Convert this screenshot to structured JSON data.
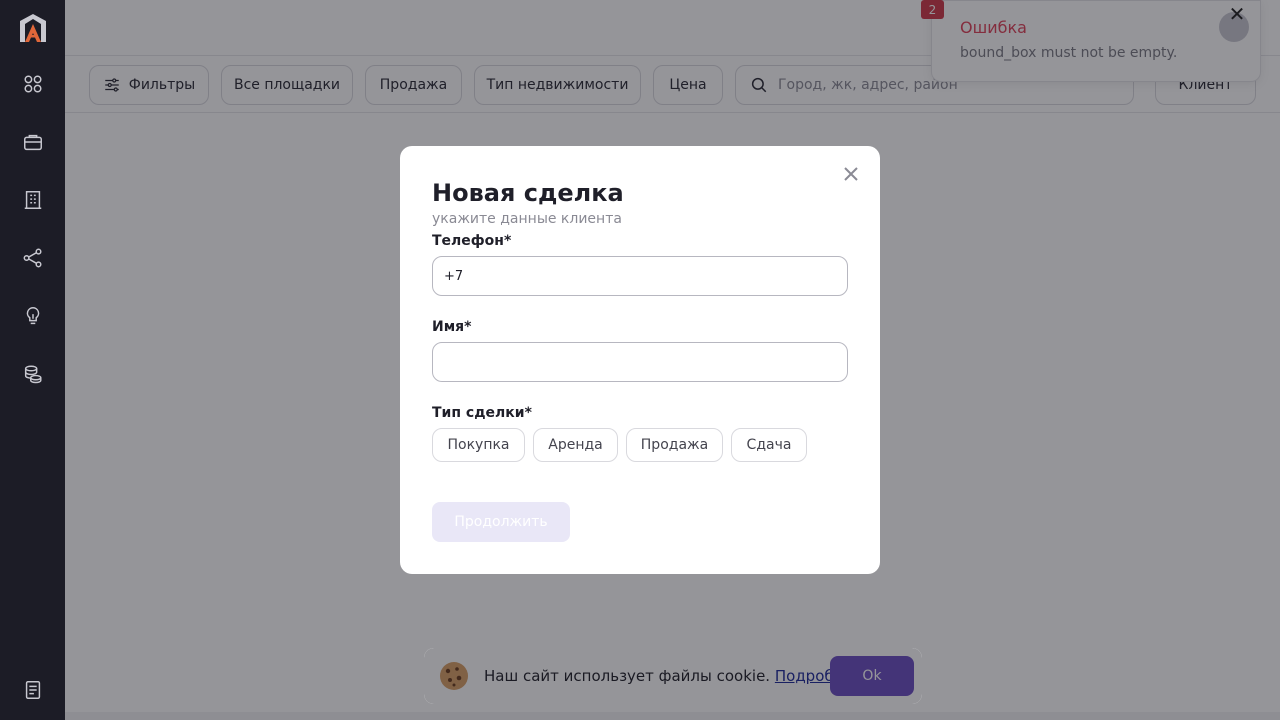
{
  "sidebar": {
    "icons": [
      "logo-icon",
      "grid-icon",
      "briefcase-icon",
      "building-icon",
      "share-icon",
      "lightbulb-icon",
      "coins-icon",
      "document-icon"
    ]
  },
  "header": {
    "notification_count": "2"
  },
  "filters": {
    "filters_label": "Фильтры",
    "all_sites": "Все площадки",
    "sale": "Продажа",
    "property_type": "Тип недвижимости",
    "price": "Цена",
    "search_placeholder": "Город, жк, адрес, район",
    "client": "Клиент"
  },
  "toast": {
    "title": "Ошибка",
    "message": "bound_box must not be empty."
  },
  "modal": {
    "title": "Новая сделка",
    "subtitle": "укажите данные клиента",
    "phone_label": "Телефон*",
    "phone_value": "+7",
    "name_label": "Имя*",
    "name_value": "",
    "deal_type_label": "Тип сделки*",
    "deal_types": [
      "Покупка",
      "Аренда",
      "Продажа",
      "Сдача"
    ],
    "continue_label": "Продолжить"
  },
  "cookie": {
    "text": "Наш сайт использует файлы cookie.",
    "link": "Подробнее",
    "ok": "Ok"
  },
  "colors": {
    "sidebar_bg": "#1c1c26",
    "accent": "#6c4fc4",
    "error": "#e0435a"
  }
}
